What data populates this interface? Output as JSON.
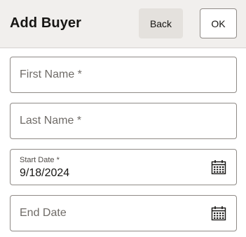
{
  "header": {
    "title": "Add Buyer",
    "back_label": "Back",
    "ok_label": "OK"
  },
  "form": {
    "first_name": {
      "placeholder": "First Name *",
      "value": ""
    },
    "last_name": {
      "placeholder": "Last Name *",
      "value": ""
    },
    "start_date": {
      "label": "Start Date *",
      "value": "9/18/2024",
      "icon": "calendar-icon"
    },
    "end_date": {
      "placeholder": "End Date",
      "value": "",
      "icon": "calendar-icon"
    }
  },
  "colors": {
    "header_bg": "#f1efed",
    "back_button_bg": "#e4e1dd",
    "border": "#8f8a86",
    "placeholder_text": "#6f6b67"
  }
}
